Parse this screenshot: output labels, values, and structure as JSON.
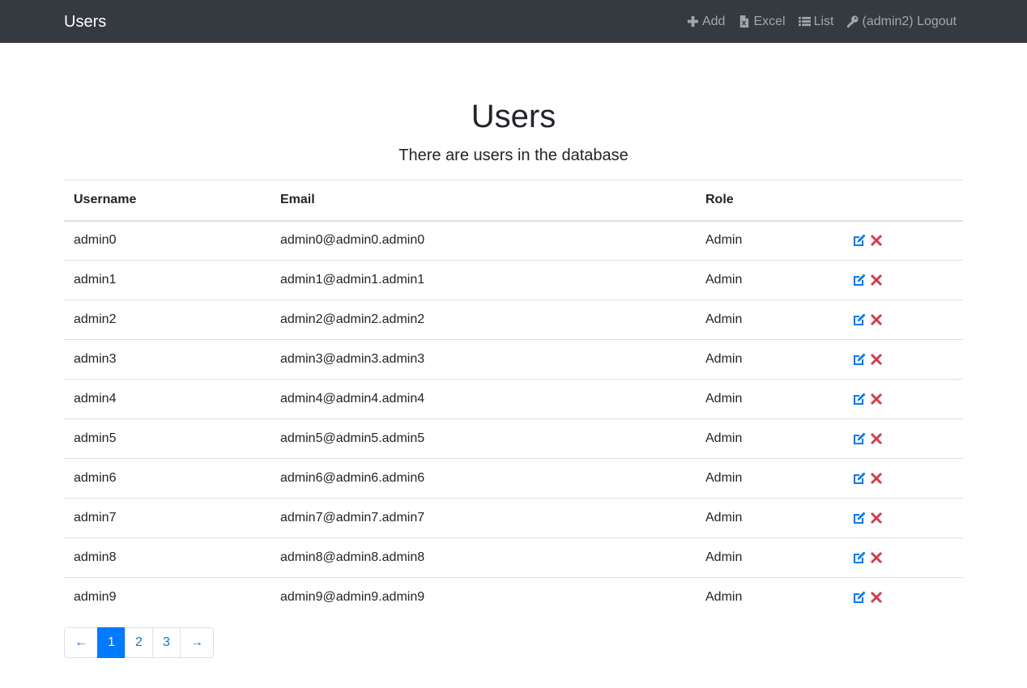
{
  "navbar": {
    "brand": "Users",
    "links": [
      {
        "label": "Add",
        "icon": "plus-icon"
      },
      {
        "label": "Excel",
        "icon": "file-excel-icon"
      },
      {
        "label": "List",
        "icon": "list-icon"
      },
      {
        "label": "(admin2) Logout",
        "icon": "key-icon"
      }
    ]
  },
  "header": {
    "title": "Users",
    "subtitle": "There are users in the database"
  },
  "table": {
    "columns": [
      "Username",
      "Email",
      "Role",
      ""
    ],
    "rows": [
      {
        "username": "admin0",
        "email": "admin0@admin0.admin0",
        "role": "Admin"
      },
      {
        "username": "admin1",
        "email": "admin1@admin1.admin1",
        "role": "Admin"
      },
      {
        "username": "admin2",
        "email": "admin2@admin2.admin2",
        "role": "Admin"
      },
      {
        "username": "admin3",
        "email": "admin3@admin3.admin3",
        "role": "Admin"
      },
      {
        "username": "admin4",
        "email": "admin4@admin4.admin4",
        "role": "Admin"
      },
      {
        "username": "admin5",
        "email": "admin5@admin5.admin5",
        "role": "Admin"
      },
      {
        "username": "admin6",
        "email": "admin6@admin6.admin6",
        "role": "Admin"
      },
      {
        "username": "admin7",
        "email": "admin7@admin7.admin7",
        "role": "Admin"
      },
      {
        "username": "admin8",
        "email": "admin8@admin8.admin8",
        "role": "Admin"
      },
      {
        "username": "admin9",
        "email": "admin9@admin9.admin9",
        "role": "Admin"
      }
    ]
  },
  "pagination": {
    "prev": "←",
    "pages": [
      "1",
      "2",
      "3"
    ],
    "active_page": "1",
    "next": "→"
  },
  "colors": {
    "navbar_bg": "#343a40",
    "link_blue": "#007bff",
    "delete_red": "#dc3545"
  }
}
